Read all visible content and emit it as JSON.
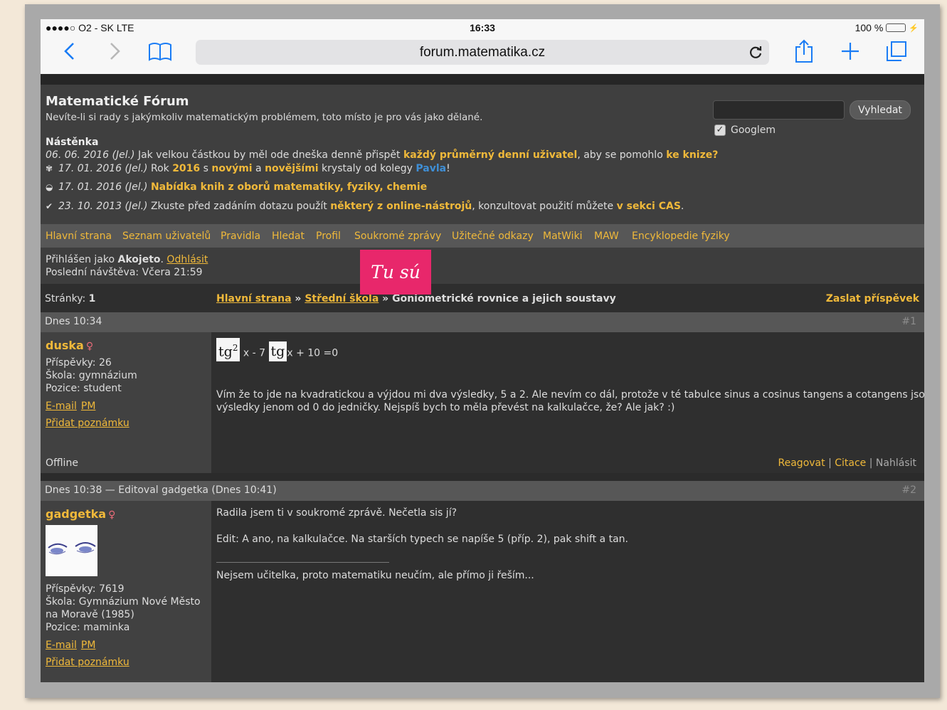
{
  "status_bar": {
    "carrier": "●●●●○ O2 - SK  LTE",
    "time": "16:33",
    "battery": "100 %"
  },
  "browser": {
    "url": "forum.matematika.cz"
  },
  "forum": {
    "title": "Matematické Fórum",
    "description": "Nevíte-li si rady s jakýmkoliv matematickým problémem, toto místo je pro vás jako dělané.",
    "search_button": "Vyhledat",
    "google_label": "Googlem",
    "board_title": "Nástěnka"
  },
  "news": [
    {
      "icon": "",
      "date": "06. 06. 2016 (Jel.)",
      "t1": " Jak velkou částkou by měl ode dneška denně přispět ",
      "h1": "každý průměrný denní uživatel",
      "t2": ", aby se pomohlo ",
      "h2": "ke knize?"
    },
    {
      "icon": "flower-icon",
      "date": "17. 01. 2016 (Jel.)",
      "t1": " Rok ",
      "h1": "2016",
      "t2": " s ",
      "h2": "novými",
      "t3": " a ",
      "h3": "novějšími",
      "t4": " krystaly od kolegy ",
      "b1": "Pavla",
      "t5": "!"
    },
    {
      "icon": "book-icon",
      "date": "17. 01. 2016 (Jel.)",
      "h1": "Nabídka knih z oborů matematiky, fyziky, chemie"
    },
    {
      "icon": "check-icon",
      "date": "23. 10. 2013 (Jel.)",
      "t1": " Zkuste před zadáním dotazu použít ",
      "h1": "některý z online-nástrojů",
      "t2": ", konzultovat použití můžete ",
      "h2": "v sekci CAS",
      "t3": "."
    }
  ],
  "nav": [
    "Hlavní strana",
    "Seznam uživatelů",
    "Pravidla",
    "Hledat",
    "Profil",
    "Soukromé zprávy",
    "Užitečné odkazy",
    "MatWiki",
    "MAW",
    "Encyklopedie fyziky"
  ],
  "user": {
    "logged_prefix": "Přihlášen jako ",
    "name": "Akojeto",
    "logout": "Odhlásit",
    "last_visit": "Poslední návštěva: Včera 21:59"
  },
  "sticker_text": "Tu sú",
  "breadcrumb": {
    "pages_label": "Stránky: ",
    "pages_value": "1",
    "home": "Hlavní strana",
    "sep": " » ",
    "section": "Střední škola",
    "topic": "Goniometrické rovnice a jejich soustavy",
    "post_reply": "Zaslat příspěvek"
  },
  "posts": [
    {
      "header": "Dnes 10:34",
      "number": "#1",
      "author": "duska",
      "posts_count": "Příspěvky: 26",
      "school": "Škola: gymnázium",
      "position": "Pozice: student",
      "email": "E-mail",
      "pm": "PM",
      "add_note": "Přidat poznámku",
      "status": "Offline",
      "math_tg1": "tg",
      "math_sup": "2",
      "math_mid": "x - 7",
      "math_tg2": "tg",
      "math_end": "x + 10 =0",
      "text": "Vím že to jde na kvadratickou a výjdou mi dva výsledky, 5 a 2. Ale nevím co dál, protože v té tabulce sinus a cosinus tangens a cotangens jsou",
      "text2": "výsledky jenom od 0 do jedničky. Nejspíš bych to měla převést na kalkulačce, že? Ale jak? :)",
      "reply": "Reagovat",
      "quote": "Citace",
      "report": "Nahlásit"
    },
    {
      "header": "Dnes 10:38 — Editoval gadgetka (Dnes 10:41)",
      "number": "#2",
      "author": "gadgetka",
      "posts_count": "Příspěvky: 7619",
      "school1": "Škola: Gymnázium Nové Město",
      "school2": "na Moravě (1985)",
      "position": "Pozice: maminka",
      "email": "E-mail",
      "pm": "PM",
      "add_note": "Přidat poznámku",
      "line1": "Radila jsem ti v soukromé zprávě. Nečetla sis jí?",
      "line2": "Edit: A ano, na kalkulačce. Na starších typech se napíše 5 (příp. 2), pak shift a tan.",
      "signature": "Nejsem učitelka, proto matematiku neučím, ale přímo ji řeším..."
    }
  ],
  "colors": {
    "accent": "#f0b93a",
    "sticker": "#e8276b",
    "link_blue": "#3f8fd6"
  }
}
